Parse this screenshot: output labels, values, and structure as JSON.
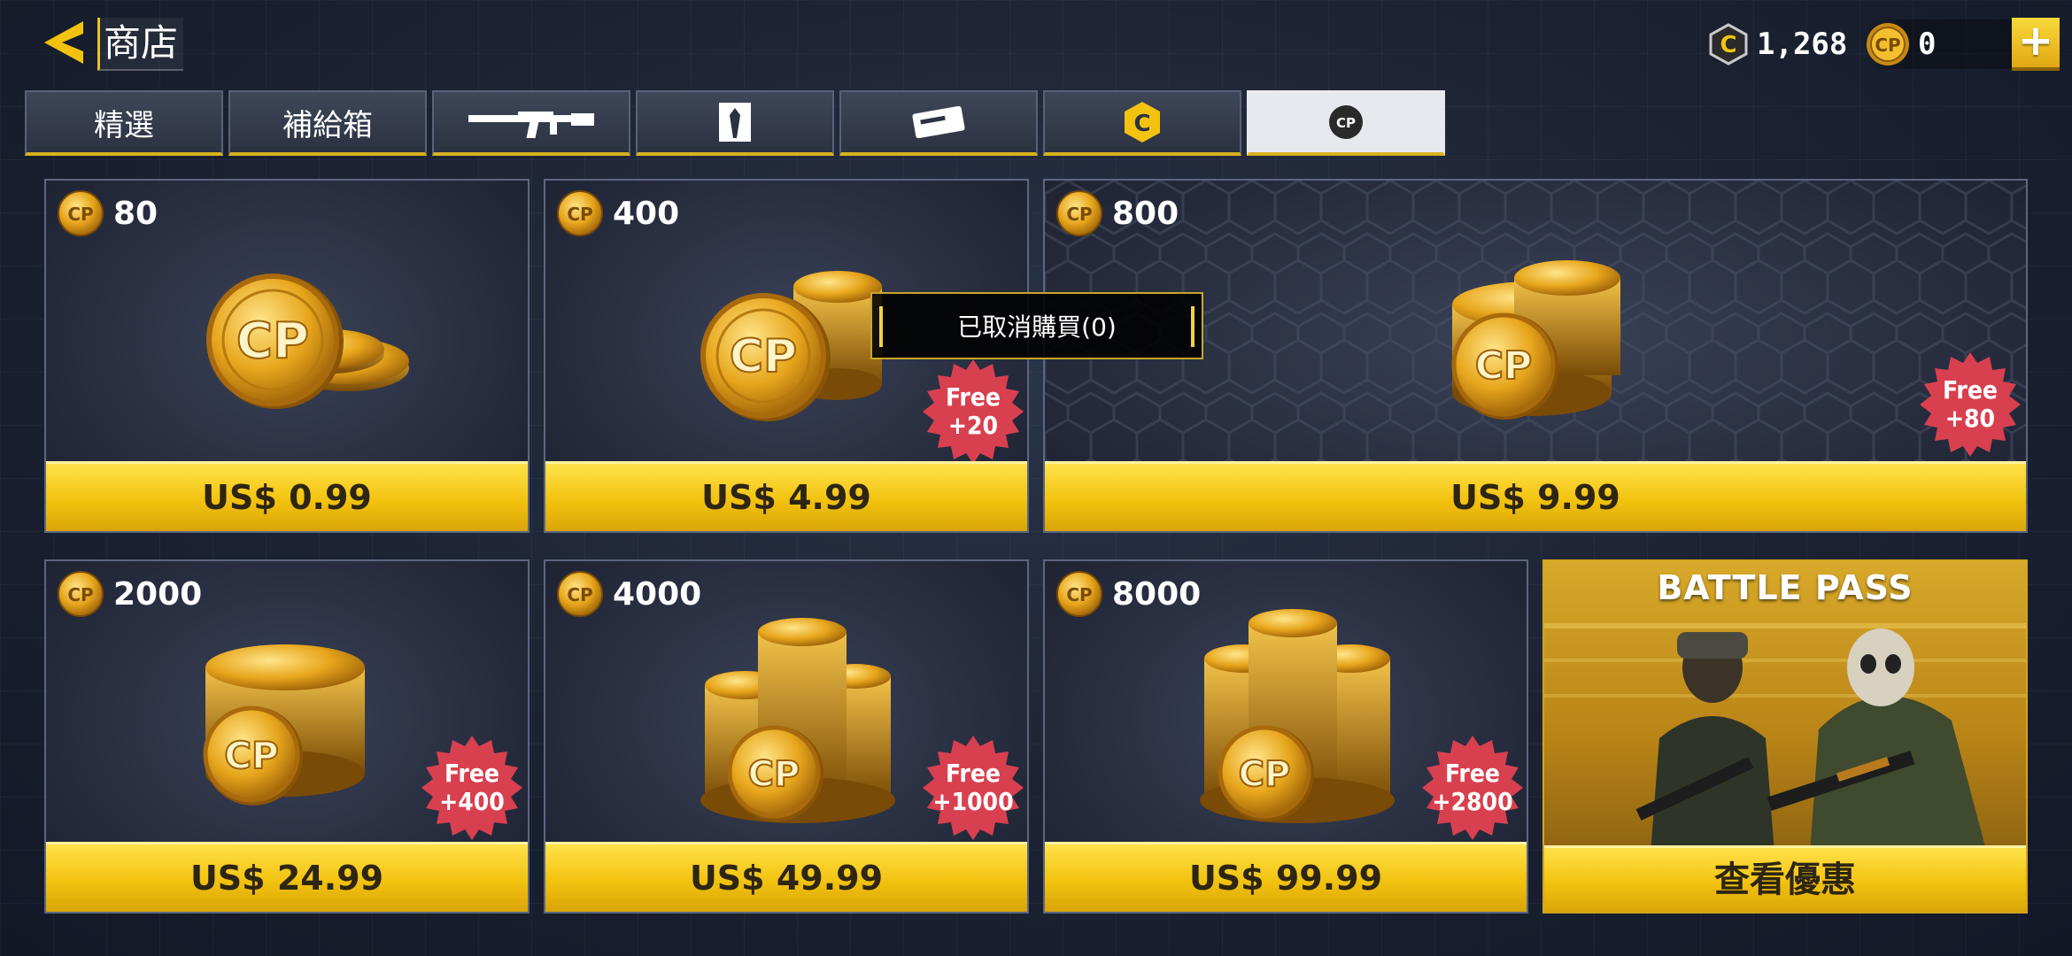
{
  "header": {
    "title": "商店",
    "cod_points": "1,268",
    "cp_points": "0",
    "plus_label": "+"
  },
  "tabs": [
    {
      "label": "精選",
      "icon": null
    },
    {
      "label": "補給箱",
      "icon": null
    },
    {
      "label": "",
      "icon": "rifle-icon"
    },
    {
      "label": "",
      "icon": "operator-icon"
    },
    {
      "label": "",
      "icon": "ticket-icon"
    },
    {
      "label": "",
      "icon": "cod-coin-icon"
    },
    {
      "label": "",
      "icon": "cp-coin-icon",
      "active": true
    }
  ],
  "offers": [
    {
      "amount": "80",
      "price": "US$ 0.99",
      "bonus": null
    },
    {
      "amount": "400",
      "price": "US$ 4.99",
      "bonus": {
        "line1": "Free",
        "line2": "+20"
      }
    },
    {
      "amount": "800",
      "price": "US$ 9.99",
      "bonus": {
        "line1": "Free",
        "line2": "+80"
      }
    },
    {
      "amount": "2000",
      "price": "US$ 24.99",
      "bonus": {
        "line1": "Free",
        "line2": "+400"
      }
    },
    {
      "amount": "4000",
      "price": "US$ 49.99",
      "bonus": {
        "line1": "Free",
        "line2": "+1000"
      }
    },
    {
      "amount": "8000",
      "price": "US$ 99.99",
      "bonus": {
        "line1": "Free",
        "line2": "+2800"
      }
    }
  ],
  "battle_pass": {
    "title": "BATTLE PASS",
    "button": "查看優惠"
  },
  "toast": {
    "text": "已取消購買(0)"
  },
  "coin_mark": "CP",
  "cod_mark": "C",
  "colors": {
    "accent_yellow": "#f2c20f",
    "badge_red": "#d9404f",
    "panel": "#242a3b"
  }
}
